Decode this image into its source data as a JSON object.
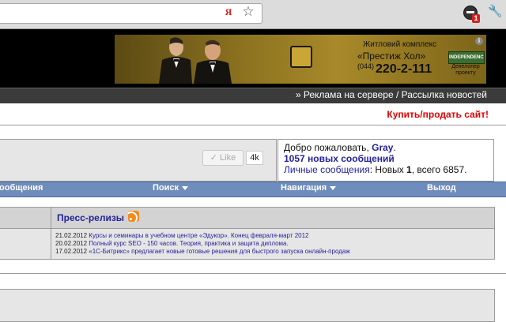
{
  "browser": {
    "star_icon": "star-icon",
    "ya_label": "Я",
    "extension_badge": "1",
    "wrench_icon": "wrench-icon"
  },
  "banner": {
    "tagline": "Житловий комплекс",
    "name": "«Престиж Хол»",
    "phone_code": "(044)",
    "phone": "220-2-111",
    "developer_logo": "INDEPENDENCE",
    "developer_caption": "Девелопер проекту",
    "info": "i"
  },
  "header": {
    "nav_link": "» Реклама на сервере / Рассылка новостей",
    "buy_link": "Купить/продать сайт!"
  },
  "social": {
    "like_label": "✓ Like",
    "like_count": "4k"
  },
  "user": {
    "welcome_prefix": "Добро пожаловать, ",
    "username": "Gray",
    "welcome_suffix": ".",
    "new_messages": "1057 новых сообщений",
    "pm_label": "Личные сообщения",
    "pm_new_prefix": ": Новых ",
    "pm_new_count": "1",
    "pm_total": ", всего 6857."
  },
  "navbar": {
    "messages": "ообщения",
    "search": "Поиск",
    "navigation": "Навигация",
    "logout": "Выход"
  },
  "press": {
    "title": "Пресс-релизы",
    "items": [
      {
        "date": "21.02.2012",
        "text": "Курсы и семинары в учебном центре «Эдукор». Конец февраля-март 2012"
      },
      {
        "date": "20.02.2012",
        "text": "Полный курс SEO - 150 часов. Теория, практика и защита диплома."
      },
      {
        "date": "17.02.2012",
        "text": "«1С-Битрикс» предлагает новые готовые решения для быстрого запуска онлайн-продаж"
      }
    ]
  },
  "colors": {
    "navbar": "#6e8cbc",
    "link": "#22229c",
    "buy_link": "#e00000",
    "header": "#000000"
  }
}
